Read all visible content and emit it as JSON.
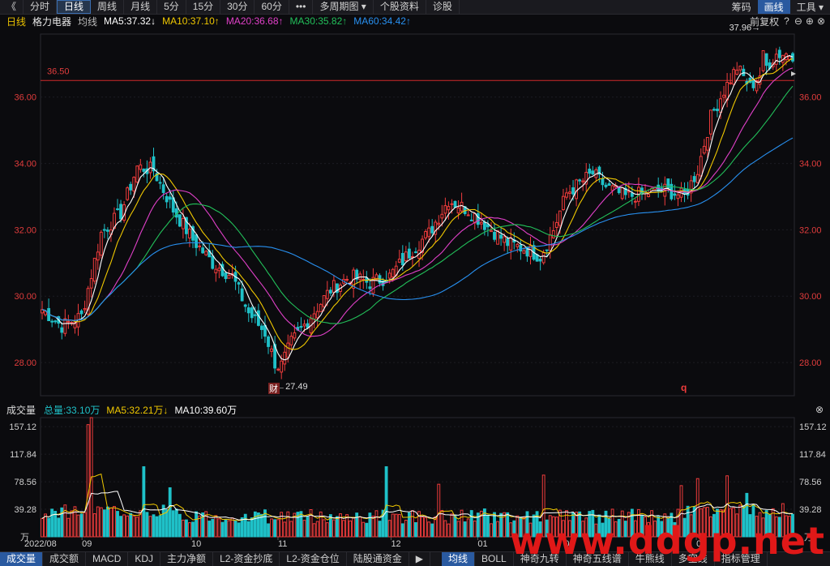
{
  "toolbar": {
    "back": "《",
    "tabs": [
      "分时",
      "日线",
      "周线",
      "月线",
      "5分",
      "15分",
      "30分",
      "60分",
      "•••",
      "多周期图 ▾",
      "个股资料",
      "诊股"
    ],
    "active_tab": 1,
    "right": [
      "筹码",
      "画线",
      "工具 ▾"
    ]
  },
  "ma_bar": {
    "period": "日线",
    "stock_name": "格力电器",
    "ma_type": "均线",
    "ma5": "MA5:37.32↓",
    "ma10": "MA10:37.10↑",
    "ma20": "MA20:36.68↑",
    "ma30": "MA30:35.82↑",
    "ma60": "MA60:34.42↑",
    "adjust": "前复权"
  },
  "vol_bar": {
    "title": "成交量",
    "total": "总量:33.10万",
    "ma5": "MA5:32.21万↓",
    "ma10": "MA10:39.60万"
  },
  "bottom_tabs": [
    "成交量",
    "成交额",
    "MACD",
    "KDJ",
    "主力净额",
    "L2-资金抄底",
    "L2-资金仓位",
    "陆股通资金",
    "▶",
    "均线",
    "BOLL",
    "神奇九转",
    "神奇五线谱",
    "牛熊线",
    "多空线",
    "指标管理"
  ],
  "bottom_active": [
    0,
    9
  ],
  "colors": {
    "up": "#f03c3c",
    "down": "#1fc1c8",
    "ma5": "#ffffff",
    "ma10": "#f0c800",
    "ma20": "#e040c8",
    "ma30": "#22c05a",
    "ma60": "#2890f0",
    "hline": "#d02a2a"
  },
  "watermark": "www.ddgp.net",
  "chart_data": {
    "type": "candlestick",
    "price_axis": {
      "ticks": [
        "36.00",
        "34.00",
        "32.00",
        "30.00",
        "28.00"
      ],
      "ylim": [
        27.0,
        37.9
      ]
    },
    "volume_axis": {
      "ticks": [
        "157.12",
        "117.84",
        "78.56",
        "39.28"
      ],
      "unit": "万",
      "ylim": [
        0,
        170
      ]
    },
    "x_labels": [
      "2022/08",
      "09",
      "10",
      "11",
      "12",
      "01",
      "02",
      "03"
    ],
    "hline": {
      "value": 36.5,
      "label": "36.50"
    },
    "annotations": {
      "high": "37.96→",
      "low": "←27.49",
      "event": "财",
      "event2": "q"
    },
    "key_points": [
      [
        0,
        29.6
      ],
      [
        6,
        29.1
      ],
      [
        12,
        29.4
      ],
      [
        18,
        31.9
      ],
      [
        24,
        32.5
      ],
      [
        29,
        33.9
      ],
      [
        34,
        33.8
      ],
      [
        40,
        32.6
      ],
      [
        46,
        31.7
      ],
      [
        52,
        31.0
      ],
      [
        58,
        30.6
      ],
      [
        63,
        29.5
      ],
      [
        68,
        28.9
      ],
      [
        72,
        27.7
      ],
      [
        76,
        28.6
      ],
      [
        82,
        29.4
      ],
      [
        88,
        30.2
      ],
      [
        94,
        30.6
      ],
      [
        100,
        30.4
      ],
      [
        106,
        30.6
      ],
      [
        112,
        31.3
      ],
      [
        118,
        31.9
      ],
      [
        124,
        32.9
      ],
      [
        130,
        32.6
      ],
      [
        136,
        32.1
      ],
      [
        142,
        31.6
      ],
      [
        148,
        31.4
      ],
      [
        152,
        31.2
      ],
      [
        156,
        32.0
      ],
      [
        160,
        33.1
      ],
      [
        164,
        33.4
      ],
      [
        168,
        33.7
      ],
      [
        172,
        33.3
      ],
      [
        178,
        33.0
      ],
      [
        184,
        33.1
      ],
      [
        190,
        33.2
      ],
      [
        196,
        33.0
      ],
      [
        200,
        33.8
      ],
      [
        204,
        35.4
      ],
      [
        208,
        36.2
      ],
      [
        212,
        36.9
      ],
      [
        216,
        36.3
      ],
      [
        220,
        36.8
      ],
      [
        224,
        37.3
      ],
      [
        229,
        37.3
      ]
    ],
    "volume_spikes": {
      "14": 160,
      "15": 170,
      "31": 100,
      "39": 70,
      "105": 100,
      "121": 75,
      "153": 88,
      "195": 73,
      "200": 83,
      "209": 87,
      "215": 62
    }
  }
}
